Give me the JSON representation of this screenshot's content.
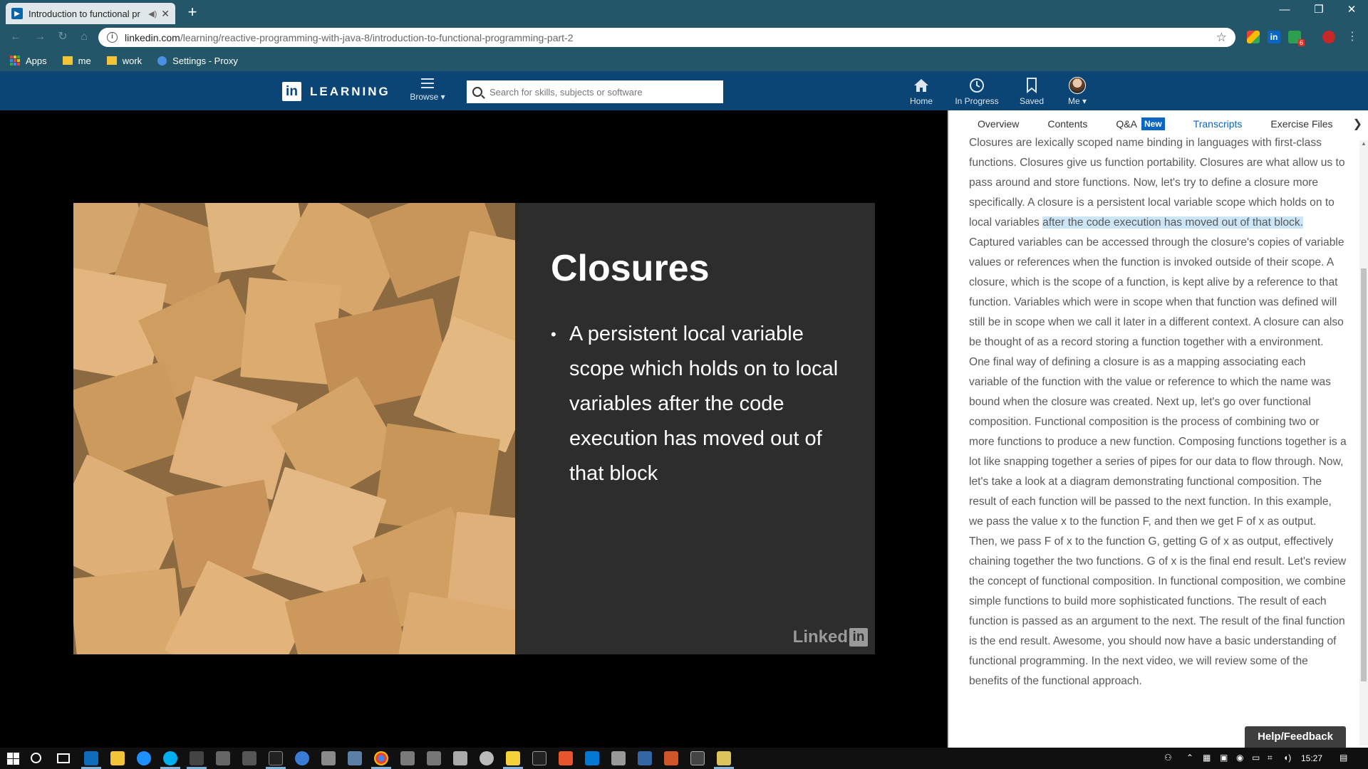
{
  "browser": {
    "tab_title": "Introduction to functional pr",
    "url_domain": "linkedin.com",
    "url_path": "/learning/reactive-programming-with-java-8/introduction-to-functional-programming-part-2",
    "bookmarks": [
      {
        "label": "Apps",
        "icon": "apps-grid-icon"
      },
      {
        "label": "me",
        "icon": "folder-icon"
      },
      {
        "label": "work",
        "icon": "folder-icon"
      },
      {
        "label": "Settings - Proxy",
        "icon": "gear-icon"
      }
    ],
    "extension_badge": "6"
  },
  "header": {
    "logo_text": "LEARNING",
    "browse_label": "Browse ▾",
    "search_placeholder": "Search for skills, subjects or software",
    "nav": [
      {
        "label": "Home",
        "icon": "home-icon"
      },
      {
        "label": "In Progress",
        "icon": "clock-icon"
      },
      {
        "label": "Saved",
        "icon": "bookmark-icon"
      },
      {
        "label": "Me ▾",
        "icon": "avatar"
      }
    ]
  },
  "slide": {
    "title": "Closures",
    "bullet": "A persistent local variable scope which holds on to local variables after the code execution has moved out of that block",
    "watermark": "Linked"
  },
  "panel": {
    "tabs": [
      {
        "label": "Overview"
      },
      {
        "label": "Contents"
      },
      {
        "label": "Q&A",
        "badge": "New"
      },
      {
        "label": "Transcripts"
      },
      {
        "label": "Exercise Files"
      }
    ],
    "transcript_before": "Closures are lexically scoped name binding in languages with first-class functions. Closures give us function portability. Closures are what allow us to pass around and store functions. Now, let's try to define a closure more specifically. A closure is a persistent local variable scope which holds on to local variables ",
    "transcript_highlight": "after the code execution has moved out of that block.",
    "transcript_after": " Captured variables can be accessed through the closure's copies of variable values or references when the function is invoked outside of their scope. A closure, which is the scope of a function, is kept alive by a reference to that function. Variables which were in scope when that function was defined will still be in scope when we call it later in a different context. A closure can also be thought of as a record storing a function together with a environment. One final way of defining a closure is as a mapping associating each variable of the function with the value or reference to which the name was bound when the closure was created. Next up, let's go over functional composition. Functional composition is the process of combining two or more functions to produce a new function. Composing functions together is a lot like snapping together a series of pipes for our data to flow through. Now, let's take a look at a diagram demonstrating functional composition. The result of each function will be passed to the next function. In this example, we pass the value x to the function F, and then we get F of x as output. Then, we pass F of x to the function G, getting G of x as output, effectively chaining together the two functions. G of x is the final end result. Let's review the concept of functional composition. In functional composition, we combine simple functions to build more sophisticated functions. The result of each function is passed as an argument to the next. The result of the final function is the end result. Awesome, you should now have a basic understanding of functional programming. In the next video, we will review some of the benefits of the functional approach.",
    "help_label": "Help/Feedback"
  },
  "taskbar": {
    "time": "15:27"
  }
}
